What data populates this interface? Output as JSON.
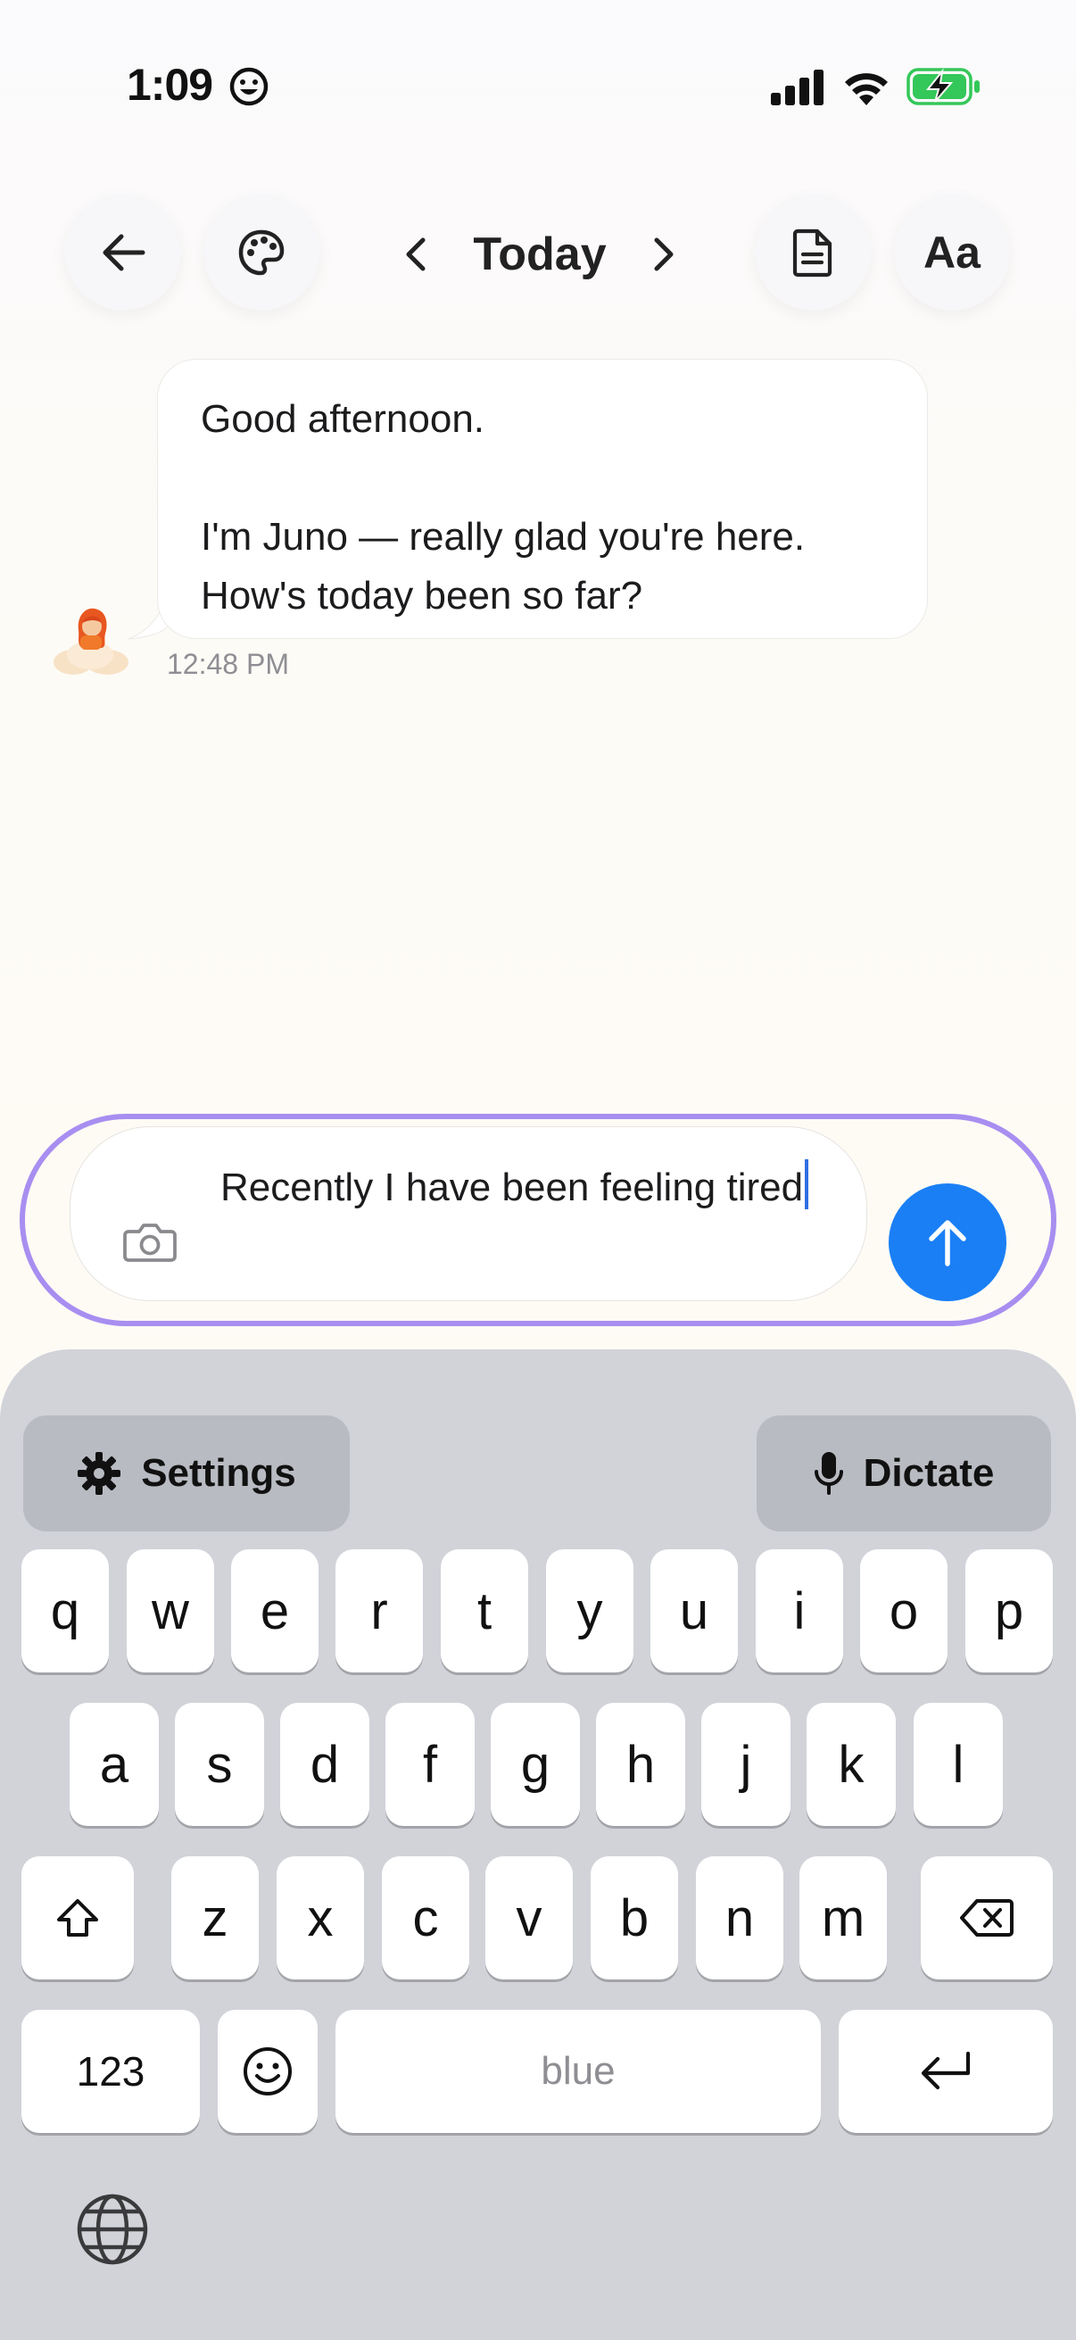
{
  "status_bar": {
    "time": "1:09"
  },
  "nav": {
    "title": "Today",
    "font_button_label": "Aa"
  },
  "chat": {
    "assistant_name": "Juno",
    "message_lines": [
      "Good afternoon.",
      "I'm Juno — really glad you're here.",
      "How's today been so far?"
    ],
    "timestamp": "12:48 PM"
  },
  "composer": {
    "text": "Recently I have been feeling tired"
  },
  "keyboard": {
    "settings_label": "Settings",
    "dictate_label": "Dictate",
    "row1": [
      "q",
      "w",
      "e",
      "r",
      "t",
      "y",
      "u",
      "i",
      "o",
      "p"
    ],
    "row2": [
      "a",
      "s",
      "d",
      "f",
      "g",
      "h",
      "j",
      "k",
      "l"
    ],
    "row3": [
      "z",
      "x",
      "c",
      "v",
      "b",
      "n",
      "m"
    ],
    "numbers_label": "123",
    "space_label": "blue"
  },
  "colors": {
    "accent_outline": "#a88ef0",
    "send_button": "#1a7ff5",
    "battery_green": "#34c759"
  },
  "icons": [
    "smiley-icon",
    "signal-icon",
    "wifi-icon",
    "battery-charging-icon",
    "back-arrow-icon",
    "palette-icon",
    "chevron-left-icon",
    "chevron-right-icon",
    "document-icon",
    "camera-icon",
    "arrow-up-icon",
    "gear-icon",
    "microphone-icon",
    "shift-icon",
    "delete-icon",
    "emoji-icon",
    "return-icon",
    "globe-icon"
  ]
}
